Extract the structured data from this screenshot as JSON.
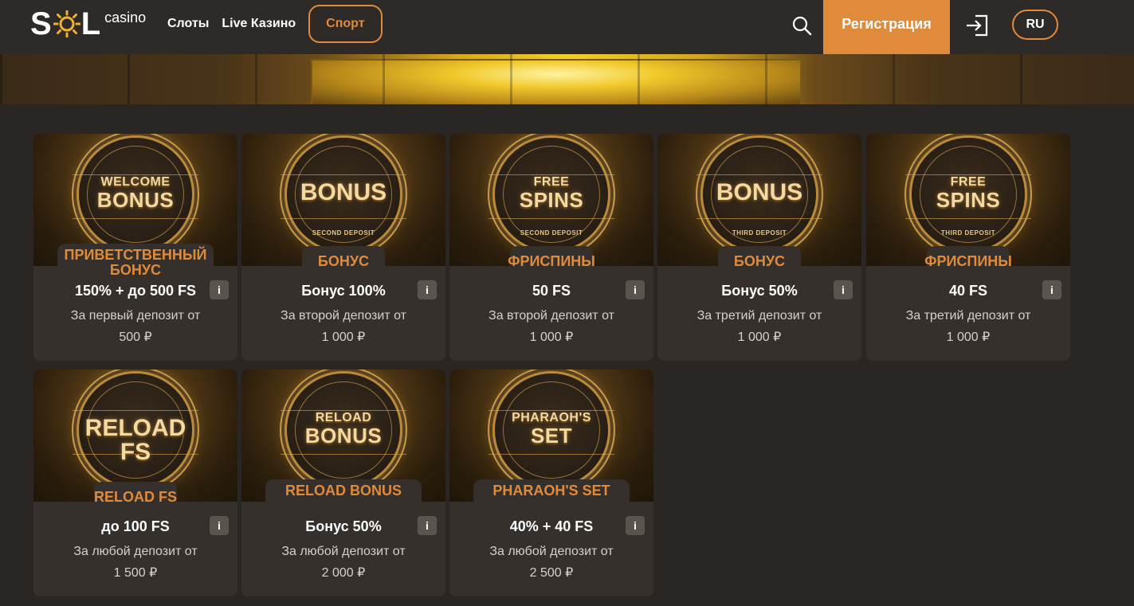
{
  "header": {
    "logo_text_left": "S",
    "logo_text_right": "L",
    "logo_sub": "casino",
    "nav": [
      "Слоты",
      "Live Казино"
    ],
    "sport_label": "Спорт",
    "register_label": "Регистрация",
    "lang_label": "RU"
  },
  "colors": {
    "accent": "#e08a3c",
    "bg": "#2a2623",
    "card": "#35302c"
  },
  "cards": [
    {
      "medal_l1": "WELCOME",
      "medal_l2": "BONUS",
      "medal_sub": "",
      "title": "ПРИВЕТСТВЕННЫЙ БОНУС",
      "amount": "150% + до 500 FS",
      "info": "i",
      "desc": "За первый депозит от",
      "min": "500 ₽"
    },
    {
      "medal_l1": "",
      "medal_l2": "BONUS",
      "medal_sub": "SECOND DEPOSIT",
      "title": "БОНУС",
      "amount": "Бонус 100%",
      "info": "i",
      "desc": "За второй депозит от",
      "min": "1 000 ₽"
    },
    {
      "medal_l1": "FREE",
      "medal_l2": "SPINS",
      "medal_sub": "SECOND DEPOSIT",
      "title": "ФРИСПИНЫ",
      "amount": "50 FS",
      "info": "i",
      "desc": "За второй депозит от",
      "min": "1 000 ₽"
    },
    {
      "medal_l1": "",
      "medal_l2": "BONUS",
      "medal_sub": "THIRD DEPOSIT",
      "title": "БОНУС",
      "amount": "Бонус 50%",
      "info": "i",
      "desc": "За третий депозит от",
      "min": "1 000 ₽"
    },
    {
      "medal_l1": "FREE",
      "medal_l2": "SPINS",
      "medal_sub": "THIRD DEPOSIT",
      "title": "ФРИСПИНЫ",
      "amount": "40 FS",
      "info": "i",
      "desc": "За третий депозит от",
      "min": "1 000 ₽"
    },
    {
      "medal_l1": "",
      "medal_l2": "RELOAD FS",
      "medal_sub": "",
      "title": "RELOAD FS",
      "amount": "до 100 FS",
      "info": "i",
      "desc": "За любой депозит от",
      "min": "1 500 ₽"
    },
    {
      "medal_l1": "RELOAD",
      "medal_l2": "BONUS",
      "medal_sub": "",
      "title": "RELOAD BONUS",
      "amount": "Бонус 50%",
      "info": "i",
      "desc": "За любой депозит от",
      "min": "2 000 ₽"
    },
    {
      "medal_l1": "PHARAOH'S",
      "medal_l2": "SET",
      "medal_sub": "",
      "title": "PHARAOH'S SET",
      "amount": "40% + 40 FS",
      "info": "i",
      "desc": "За любой депозит от",
      "min": "2 500 ₽"
    }
  ]
}
